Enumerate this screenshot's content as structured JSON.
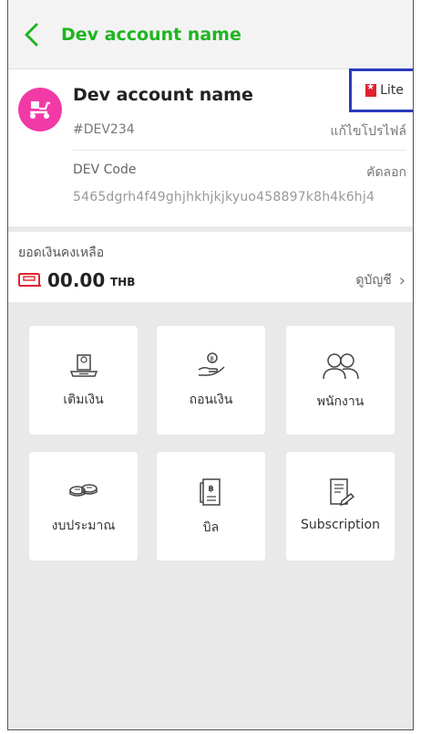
{
  "header": {
    "title": "Dev account name",
    "back_icon": "chevron-left-icon"
  },
  "profile": {
    "name": "Dev account name",
    "badge": "Lite",
    "id": "#DEV234",
    "edit_label": "แก้ไขโปรไฟล์",
    "code_label": "DEV Code",
    "copy_label": "คัดลอก",
    "code_value": "5465dgrh4f49ghjhkhjkjkyuo458897k8h4k6hj4"
  },
  "balance": {
    "label": "ยอดเงินคงเหลือ",
    "amount": "00.00",
    "currency": "THB",
    "view_label": "ดูบัญชี"
  },
  "menu": [
    {
      "label": "เติมเงิน",
      "icon": "top-up-icon"
    },
    {
      "label": "ถอนเงิน",
      "icon": "withdraw-icon"
    },
    {
      "label": "พนักงาน",
      "icon": "staff-icon"
    },
    {
      "label": "งบประมาณ",
      "icon": "budget-icon"
    },
    {
      "label": "บิล",
      "icon": "bill-icon"
    },
    {
      "label": "Subscription",
      "icon": "subscription-icon"
    }
  ],
  "colors": {
    "brand_green": "#1fb51f",
    "avatar": "#f23aa6",
    "badge_red": "#e0232e",
    "highlight": "#2a3bbd"
  }
}
